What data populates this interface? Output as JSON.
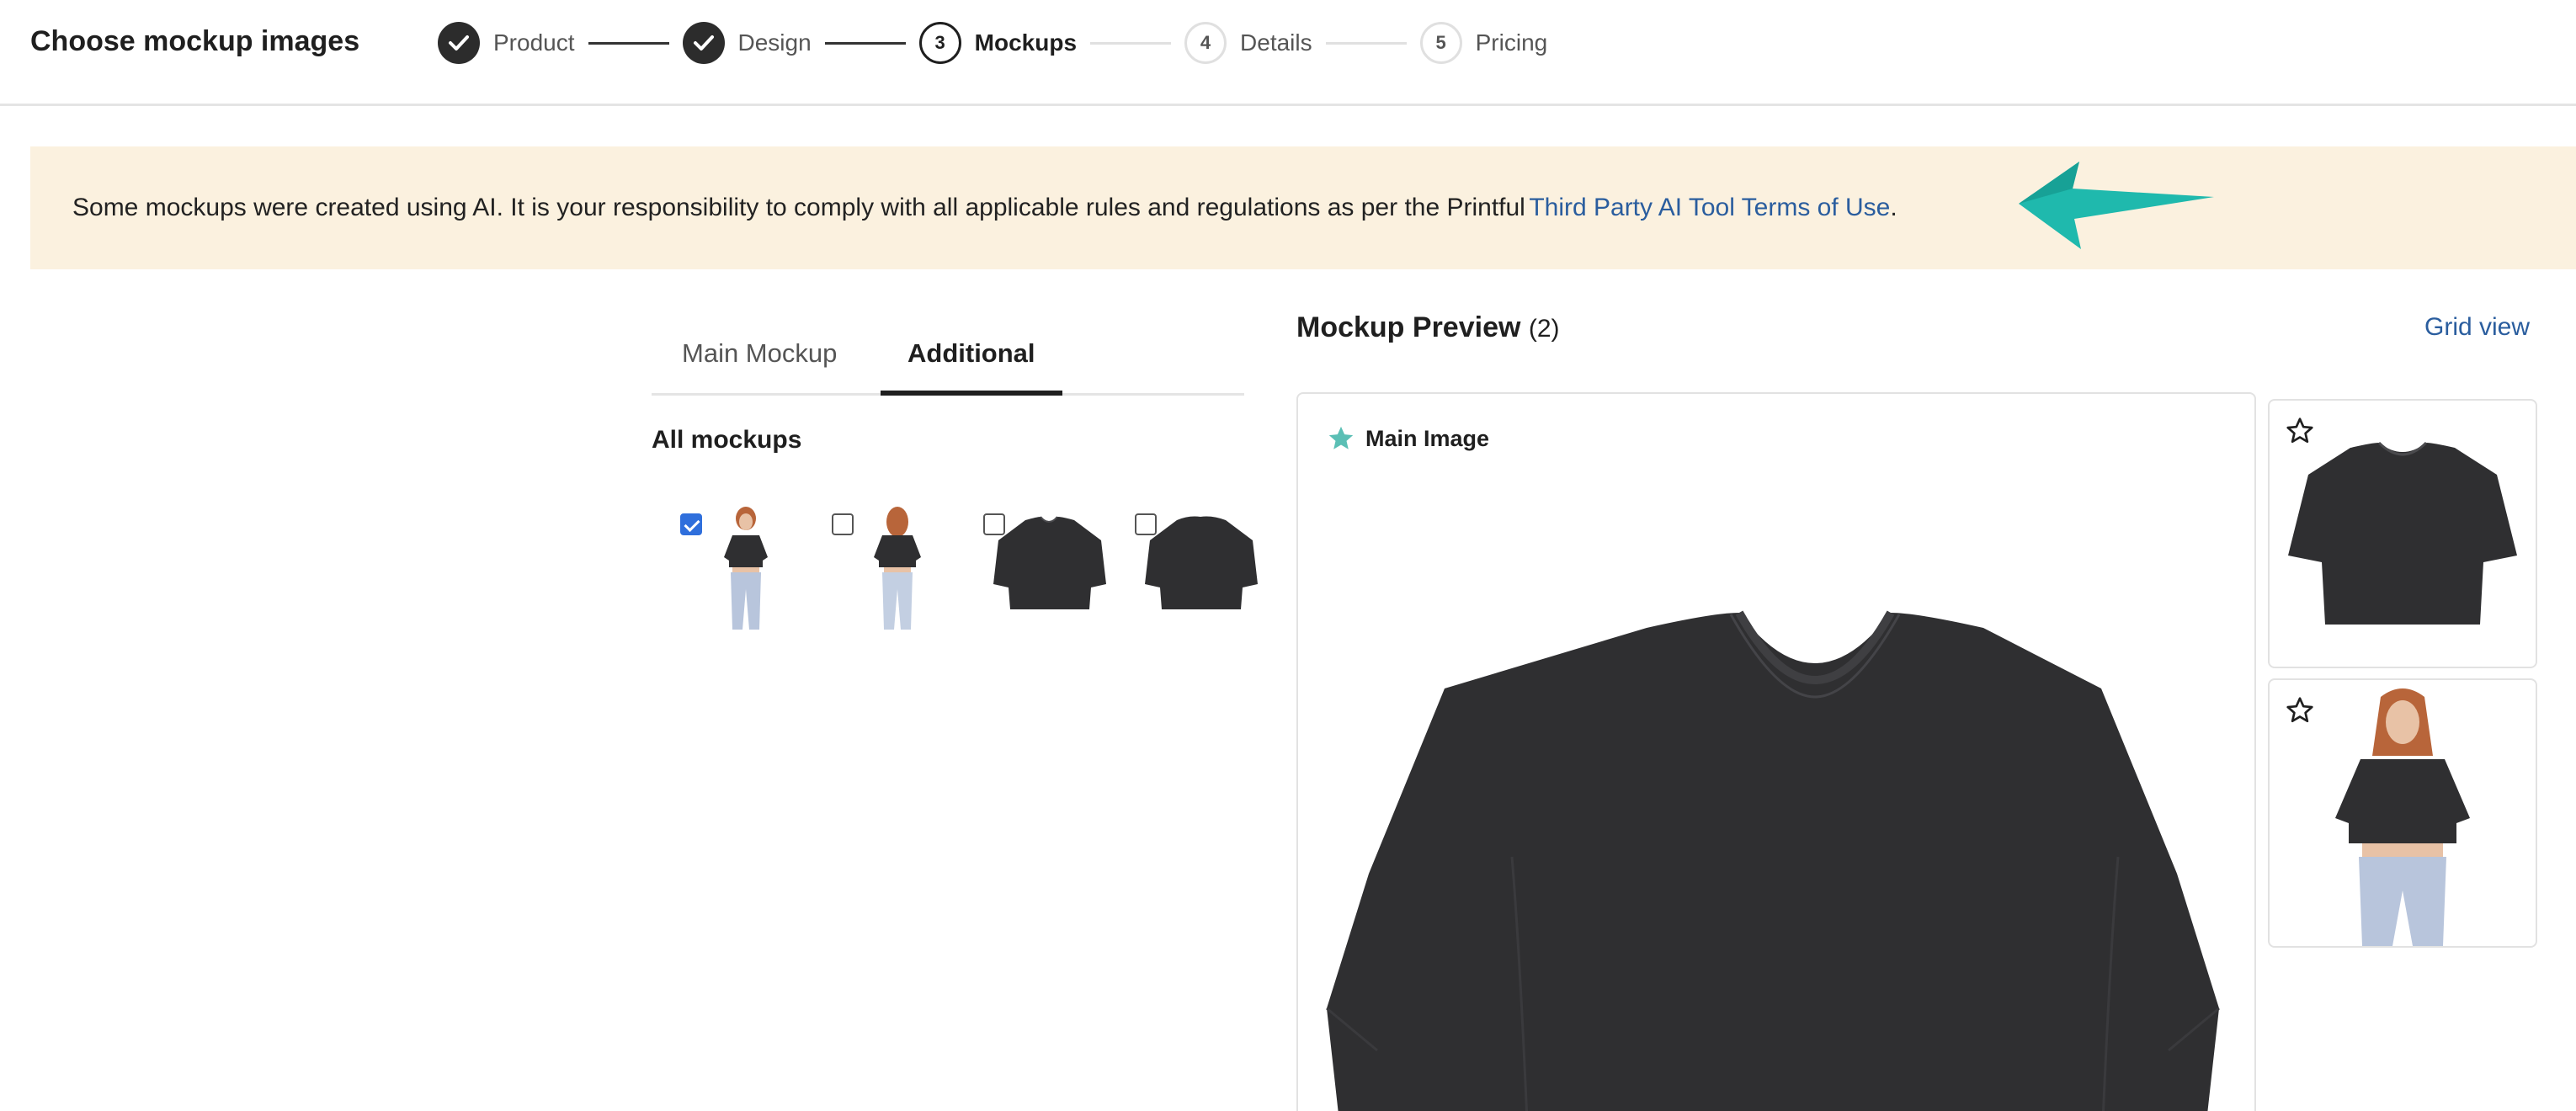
{
  "header": {
    "title": "Choose mockup images",
    "steps": [
      {
        "number": "",
        "label": "Product",
        "state": "done"
      },
      {
        "number": "",
        "label": "Design",
        "state": "done"
      },
      {
        "number": "3",
        "label": "Mockups",
        "state": "current"
      },
      {
        "number": "4",
        "label": "Details",
        "state": "todo"
      },
      {
        "number": "5",
        "label": "Pricing",
        "state": "todo"
      }
    ]
  },
  "banner": {
    "text": "Some mockups were created using AI. It is your responsibility to comply with all applicable rules and regulations as per the Printful ",
    "link_text": "Third Party AI Tool Terms of Use",
    "suffix": ".",
    "arrow_color": "#1fb9ad"
  },
  "tabs": [
    {
      "label": "Main Mockup",
      "active": false
    },
    {
      "label": "Additional",
      "active": true
    }
  ],
  "mockups": {
    "heading": "All mockups",
    "items": [
      {
        "kind": "model-front",
        "checked": true
      },
      {
        "kind": "model-back",
        "checked": false
      },
      {
        "kind": "shirt-flat-front",
        "checked": false
      },
      {
        "kind": "shirt-flat-back",
        "checked": false
      }
    ]
  },
  "preview": {
    "title": "Mockup Preview",
    "count": "(2)",
    "grid_view_label": "Grid view",
    "main_badge": "Main Image",
    "accent": "#5bbfb5"
  },
  "colors": {
    "link": "#2a5d9e",
    "banner_bg": "#fbf1df",
    "shirt": "#2f2f31"
  }
}
